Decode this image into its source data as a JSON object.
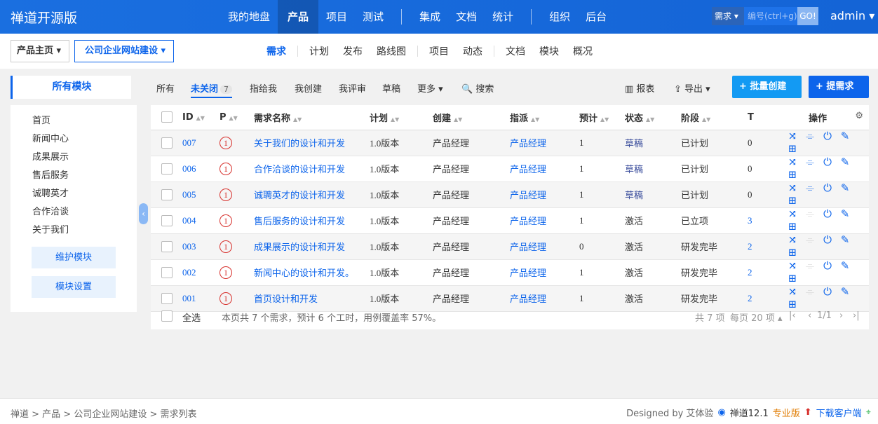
{
  "app": {
    "brand": "禅道开源版",
    "user": "admin ▾"
  },
  "mainnav": [
    "我的地盘",
    "产品",
    "项目",
    "测试",
    "集成",
    "文档",
    "统计",
    "组织",
    "后台"
  ],
  "search": {
    "type": "需求 ▾",
    "placeholder": "编号(ctrl+g)",
    "go": "GO!"
  },
  "subnav": {
    "home": "产品主页 ▾",
    "product": "公司企业网站建设 ▾",
    "items": [
      "需求",
      "计划",
      "发布",
      "路线图",
      "项目",
      "动态",
      "文档",
      "模块",
      "概况"
    ]
  },
  "sidebar": {
    "title": "所有模块",
    "modules": [
      "首页",
      "新闻中心",
      "成果展示",
      "售后服务",
      "诚聘英才",
      "合作洽谈",
      "关于我们"
    ],
    "btn_maintain": "维护模块",
    "btn_settings": "模块设置"
  },
  "filters": {
    "all": "所有",
    "unclosed": "未关闭",
    "unclosed_count": "7",
    "assigned": "指给我",
    "created": "我创建",
    "reviewed": "我评审",
    "draft": "草稿",
    "more": "更多 ▾",
    "search": "🔍 搜索",
    "report": "报表",
    "export": "导出 ▾",
    "batch": "+ 批量创建",
    "new": "+ 提需求"
  },
  "table": {
    "headers": [
      "ID",
      "P",
      "需求名称",
      "计划",
      "创建",
      "指派",
      "预计",
      "状态",
      "阶段",
      "T",
      "操作"
    ],
    "rows": [
      {
        "id": "007",
        "p": "1",
        "name": "关于我们的设计和开发",
        "plan": "1.0版本",
        "creator": "产品经理",
        "assign": "产品经理",
        "est": "1",
        "status": "草稿",
        "stage": "已计划",
        "t": "0"
      },
      {
        "id": "006",
        "p": "1",
        "name": "合作洽谈的设计和开发",
        "plan": "1.0版本",
        "creator": "产品经理",
        "assign": "产品经理",
        "est": "1",
        "status": "草稿",
        "stage": "已计划",
        "t": "0"
      },
      {
        "id": "005",
        "p": "1",
        "name": "诚聘英才的设计和开发",
        "plan": "1.0版本",
        "creator": "产品经理",
        "assign": "产品经理",
        "est": "1",
        "status": "草稿",
        "stage": "已计划",
        "t": "0"
      },
      {
        "id": "004",
        "p": "1",
        "name": "售后服务的设计和开发",
        "plan": "1.0版本",
        "creator": "产品经理",
        "assign": "产品经理",
        "est": "1",
        "status": "激活",
        "stage": "已立项",
        "t": "3"
      },
      {
        "id": "003",
        "p": "1",
        "name": "成果展示的设计和开发",
        "plan": "1.0版本",
        "creator": "产品经理",
        "assign": "产品经理",
        "est": "0",
        "status": "激活",
        "stage": "研发完毕",
        "t": "2"
      },
      {
        "id": "002",
        "p": "1",
        "name": "新闻中心的设计和开发。",
        "plan": "1.0版本",
        "creator": "产品经理",
        "assign": "产品经理",
        "est": "1",
        "status": "激活",
        "stage": "研发完毕",
        "t": "2"
      },
      {
        "id": "001",
        "p": "1",
        "name": "首页设计和开发",
        "plan": "1.0版本",
        "creator": "产品经理",
        "assign": "产品经理",
        "est": "1",
        "status": "激活",
        "stage": "研发完毕",
        "t": "2"
      }
    ],
    "select_all": "全选",
    "summary": "本页共 7 个需求，预计 6 个工时，用例覆盖率 57%。",
    "total": "共 7 项",
    "per_page": "每页 20 项 ▴",
    "page": "1/1"
  },
  "footer": {
    "crumbs": "禅道 > 产品 > 公司企业网站建设 > 需求列表",
    "designed": "Designed by 艾体验",
    "version": "禅道12.1",
    "pro": "专业版",
    "download": "下载客户端"
  }
}
